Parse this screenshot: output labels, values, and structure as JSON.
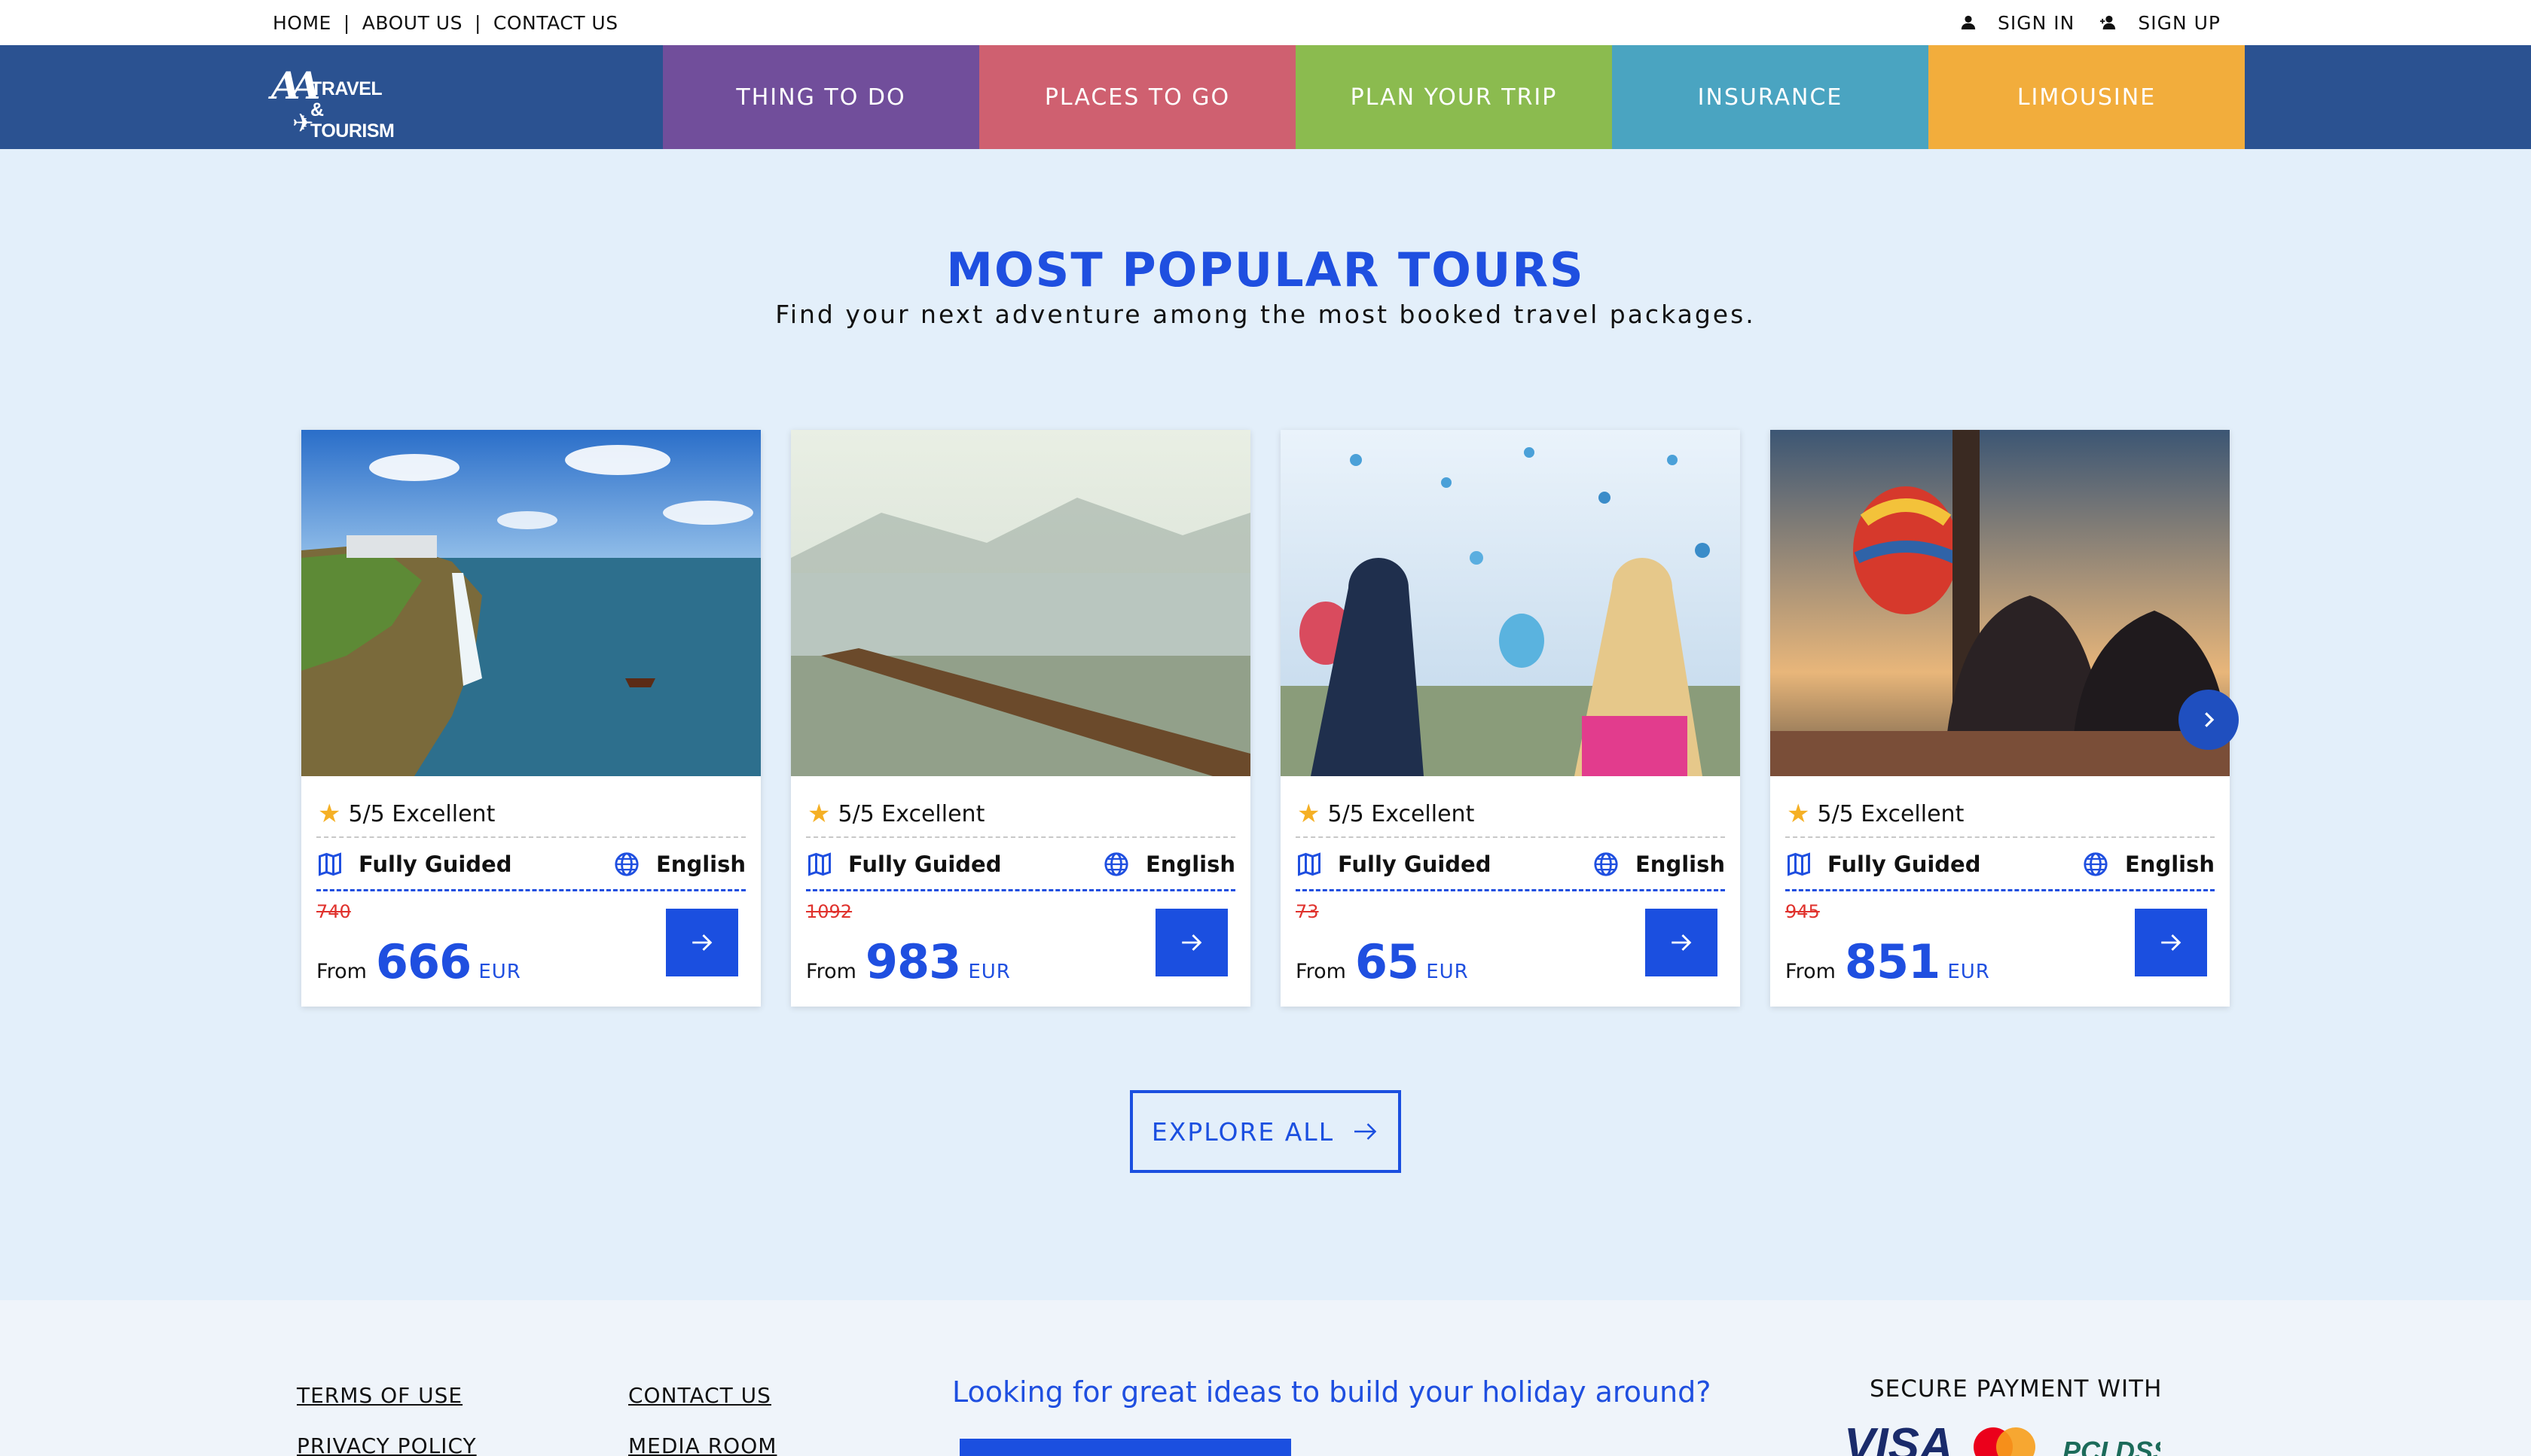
{
  "topbar": {
    "links": [
      "HOME",
      "ABOUT US",
      "CONTACT US"
    ],
    "separator": "|",
    "sign_in": "SIGN IN",
    "sign_up": "SIGN UP"
  },
  "logo": {
    "mark": "AA",
    "line1": "TRAVEL &",
    "line2": "TOURISM"
  },
  "nav": {
    "items": [
      {
        "label": "THING TO DO",
        "color": "#714e9b"
      },
      {
        "label": "PLACES TO GO",
        "color": "#cf6070"
      },
      {
        "label": "PLAN YOUR TRIP",
        "color": "#8bbb4f"
      },
      {
        "label": "INSURANCE",
        "color": "#4aa4c1"
      },
      {
        "label": "LIMOUSINE",
        "color": "#f2ad3c"
      }
    ]
  },
  "section": {
    "title": "MOST POPULAR TOURS",
    "subtitle": "Find your next adventure among the most booked travel packages."
  },
  "tours": [
    {
      "image": "waterfall-coast-photo",
      "rating": "5/5 Excellent",
      "guided": "Fully Guided",
      "language": "English",
      "old_price": "740",
      "from": "From",
      "price": "666",
      "currency": "EUR"
    },
    {
      "image": "lake-pier-photo",
      "rating": "5/5 Excellent",
      "guided": "Fully Guided",
      "language": "English",
      "old_price": "1092",
      "from": "From",
      "price": "983",
      "currency": "EUR"
    },
    {
      "image": "balloons-couple-photo",
      "rating": "5/5 Excellent",
      "guided": "Fully Guided",
      "language": "English",
      "old_price": "73",
      "from": "From",
      "price": "65",
      "currency": "EUR"
    },
    {
      "image": "balloon-basket-photo",
      "rating": "5/5 Excellent",
      "guided": "Fully Guided",
      "language": "English",
      "old_price": "945",
      "from": "From",
      "price": "851",
      "currency": "EUR"
    }
  ],
  "explore": {
    "label": "EXPLORE ALL"
  },
  "footer": {
    "col1": [
      "TERMS OF USE",
      "PRIVACY POLICY"
    ],
    "col2": [
      "CONTACT US",
      "MEDIA ROOM"
    ],
    "looking": "Looking for great ideas to build your holiday around?",
    "secure": "SECURE PAYMENT WITH",
    "payment_logos": [
      "VISA",
      "Mastercard",
      "PCI DSS"
    ]
  },
  "colors": {
    "accent": "#1f4fe0",
    "nav_bg": "#2b5291",
    "page_bg": "#e3effa",
    "old_price": "#e0322d",
    "star": "#f5b025"
  }
}
